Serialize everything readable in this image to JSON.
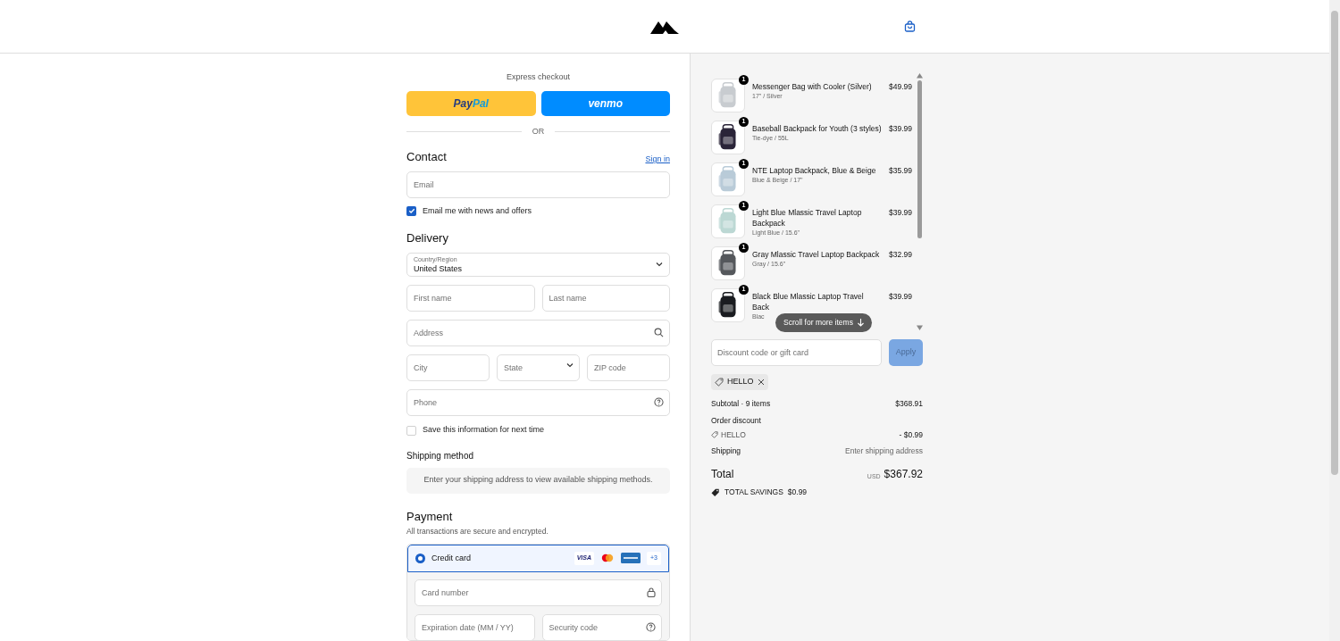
{
  "express": {
    "title": "Express checkout",
    "buttons": [
      {
        "kind": "paypal",
        "label_a": "Pay",
        "label_b": "Pal"
      },
      {
        "kind": "venmo",
        "label_a": "venmo"
      }
    ],
    "divider": "OR"
  },
  "contact": {
    "title": "Contact",
    "sign_in": "Sign in",
    "email": {
      "placeholder": "Email"
    },
    "newsletter": {
      "label": "Email me with news and offers",
      "checked": true
    }
  },
  "delivery": {
    "title": "Delivery",
    "country": {
      "label": "Country/Region",
      "value": "United States"
    },
    "fields": [
      {
        "kind": "text",
        "placeholder": "First name"
      },
      {
        "kind": "text",
        "placeholder": "Last name"
      },
      {
        "kind": "search",
        "placeholder": "Address"
      },
      {
        "kind": "text",
        "placeholder": "City"
      },
      {
        "kind": "select",
        "placeholder": "State"
      },
      {
        "kind": "text",
        "placeholder": "ZIP code"
      },
      {
        "kind": "help",
        "placeholder": "Phone"
      }
    ],
    "save": {
      "label": "Save this information for next time",
      "checked": false
    }
  },
  "shipping": {
    "title": "Shipping method",
    "notice": "Enter your shipping address to view available shipping methods."
  },
  "payment": {
    "title": "Payment",
    "subtitle": "All transactions are secure and encrypted.",
    "method": {
      "label": "Credit card",
      "selected": true,
      "cards": [
        "VISA",
        "+3"
      ]
    },
    "fields": [
      {
        "kind": "lock",
        "placeholder": "Card number"
      },
      {
        "kind": "text",
        "placeholder": "Expiration date (MM / YY)"
      },
      {
        "kind": "help",
        "placeholder": "Security code"
      }
    ]
  },
  "order": {
    "items": [
      {
        "name": "Messenger Bag with Cooler (Silver)",
        "variant": "17\" / Silver",
        "price": "$49.99",
        "quantity": "1",
        "color": "#c8ccd0"
      },
      {
        "name": "Baseball Backpack for Youth (3 styles)",
        "variant": "Tie-dye / 55L",
        "price": "$39.99",
        "quantity": "1",
        "color": "#2a2438"
      },
      {
        "name": "NTE Laptop Backpack, Blue & Beige",
        "variant": "Blue & Beige / 17\"",
        "price": "$35.99",
        "quantity": "1",
        "color": "#b9cbd8"
      },
      {
        "name": "Light Blue Mlassic Travel Laptop Backpack",
        "variant": "Light Blue / 15.6\"",
        "price": "$39.99",
        "quantity": "1",
        "color": "#bcd8d4"
      },
      {
        "name": "Gray Mlassic Travel Laptop Backpack",
        "variant": "Gray / 15.6\"",
        "price": "$32.99",
        "quantity": "1",
        "color": "#55585c"
      },
      {
        "name": "Black Blue Mlassic Laptop Travel Back",
        "variant": "Blac",
        "price": "$39.99",
        "quantity": "1",
        "color": "#1a1c20"
      }
    ],
    "scroll_hint": "Scroll for more items",
    "discount": {
      "placeholder": "Discount code or gift card",
      "button": "Apply",
      "disabled": true
    },
    "applied_code": "HELLO",
    "subtotal": {
      "label": "Subtotal · 9 items",
      "value": "$368.91"
    },
    "order_discount": {
      "label": "Order discount",
      "code": "HELLO",
      "value": "- $0.99"
    },
    "shipping": {
      "label": "Shipping",
      "value": "Enter shipping address"
    },
    "total": {
      "label": "Total",
      "currency": "USD",
      "value": "$367.92"
    },
    "savings": {
      "label": "TOTAL SAVINGS",
      "value": "$0.99"
    }
  }
}
